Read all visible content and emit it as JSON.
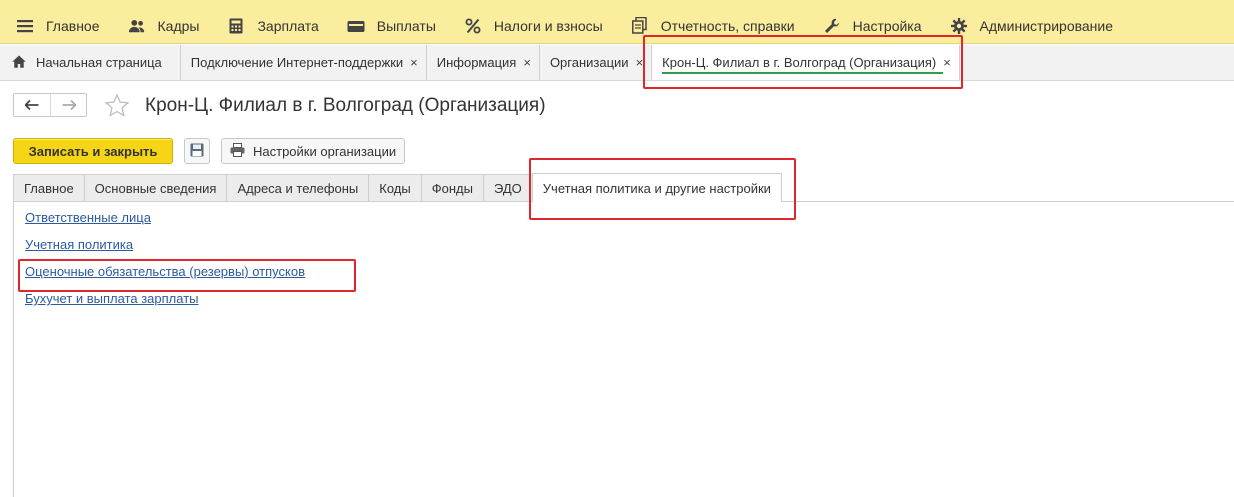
{
  "menu": [
    {
      "label": "Главное",
      "icon": "hamburger-icon"
    },
    {
      "label": "Кадры",
      "icon": "people-icon"
    },
    {
      "label": "Зарплата",
      "icon": "calculator-icon"
    },
    {
      "label": "Выплаты",
      "icon": "wallet-icon"
    },
    {
      "label": "Налоги и взносы",
      "icon": "percent-icon"
    },
    {
      "label": "Отчетность, справки",
      "icon": "documents-icon"
    },
    {
      "label": "Настройка",
      "icon": "wrench-icon"
    },
    {
      "label": "Администрирование",
      "icon": "gear-icon"
    }
  ],
  "window_tabs": [
    {
      "label": "Начальная страница",
      "icon": "home-icon",
      "closable": false
    },
    {
      "label": "Подключение Интернет-поддержки",
      "closable": true
    },
    {
      "label": "Информация",
      "closable": true
    },
    {
      "label": "Организации",
      "closable": true
    },
    {
      "label": "Крон-Ц. Филиал в г. Волгоград (Организация)",
      "closable": true,
      "active": true
    }
  ],
  "close_glyph": "×",
  "header": {
    "back_icon": "arrow-left-icon",
    "forward_icon": "arrow-right-icon",
    "favorite_icon": "star-icon",
    "title": "Крон-Ц. Филиал в г. Волгоград (Организация)"
  },
  "commands": {
    "save_close_label": "Записать и закрыть",
    "save_icon": "floppy-icon",
    "settings_label": "Настройки организации",
    "settings_icon": "printer-icon"
  },
  "form_tabs": [
    {
      "label": "Главное"
    },
    {
      "label": "Основные сведения"
    },
    {
      "label": "Адреса и телефоны"
    },
    {
      "label": "Коды"
    },
    {
      "label": "Фонды"
    },
    {
      "label": "ЭДО"
    },
    {
      "label": "Учетная политика и другие настройки",
      "active": true
    }
  ],
  "links": [
    {
      "label": "Ответственные лица"
    },
    {
      "label": "Учетная политика"
    },
    {
      "label": "Оценочные обязательства (резервы) отпусков"
    },
    {
      "label": "Бухучет и выплата зарплаты"
    }
  ],
  "colors": {
    "menubar": "#fbed9e",
    "primary_button": "#f5d515",
    "link": "#2c5aa0",
    "highlight": "#e0252b",
    "active_tab_underline": "#2e9b50"
  }
}
